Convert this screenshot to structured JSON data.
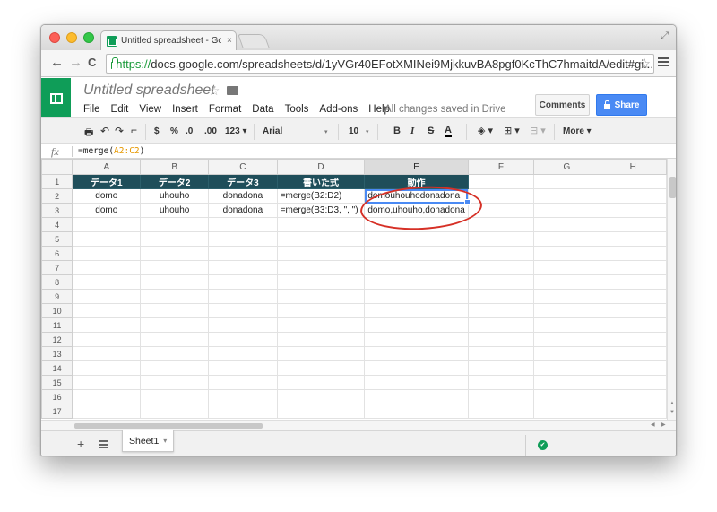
{
  "browser": {
    "tab_title": "Untitled spreadsheet - Go",
    "tab_close": "×",
    "url_scheme": "https://",
    "url_rest": "docs.google.com/spreadsheets/d/1yVGr40EFotXMINei9MjkkuvBA8pgf0KcThC7hmaitdA/edit#gi...",
    "back": "←",
    "forward": "→",
    "reload": "C",
    "star": "☆",
    "expand": "⤢"
  },
  "doc": {
    "title": "Untitled spreadsheet",
    "title_star": "☆",
    "menu": [
      "File",
      "Edit",
      "View",
      "Insert",
      "Format",
      "Data",
      "Tools",
      "Add-ons",
      "Help"
    ],
    "save_status": "All changes saved in Drive",
    "comments_label": "Comments",
    "share_label": "Share"
  },
  "format_toolbar": {
    "print": "🖶",
    "undo": "↶",
    "redo": "↷",
    "paint": "⌐",
    "currency": "$",
    "percent": "%",
    "dec_less": ".0_",
    "dec_more": ".00",
    "more_formats": "123 ▾",
    "font": "Arial",
    "font_dd": "▾",
    "size": "10",
    "size_dd": "▾",
    "bold": "B",
    "italic": "I",
    "strike": "S",
    "text_color": "A",
    "fill": "◈ ▾",
    "borders": "⊞ ▾",
    "merge": "⊟ ▾",
    "more": "More ▾"
  },
  "formula_bar": {
    "fx": "fx",
    "formula_prefix": "=merge(",
    "formula_ref": "A2:C2",
    "formula_suffix": ")"
  },
  "grid": {
    "columns": [
      "A",
      "B",
      "C",
      "D",
      "E",
      "F",
      "G",
      "H"
    ],
    "row_numbers": [
      "1",
      "2",
      "3",
      "4",
      "5",
      "6",
      "7",
      "8",
      "9",
      "10",
      "11",
      "12",
      "13",
      "14",
      "15",
      "16",
      "17"
    ],
    "header_row": [
      "データ1",
      "データ2",
      "データ3",
      "書いた式",
      "動作"
    ],
    "rows": [
      [
        "domo",
        "uhouho",
        "donadona",
        "=merge(B2:D2)",
        "domouhouhodonadona"
      ],
      [
        "domo",
        "uhouho",
        "donadona",
        "=merge(B3:D3, \", \")",
        "domo,uhouho,donadona"
      ]
    ]
  },
  "sheets": {
    "add": "+",
    "tabs": [
      {
        "label": "Sheet1",
        "dropdown": "▾"
      }
    ],
    "explore": "✔"
  },
  "colors": {
    "header_fill": "#1f4e5a",
    "share_blue": "#4a8af4",
    "sheets_green": "#0f9d58",
    "annotation_red": "#d63026"
  }
}
